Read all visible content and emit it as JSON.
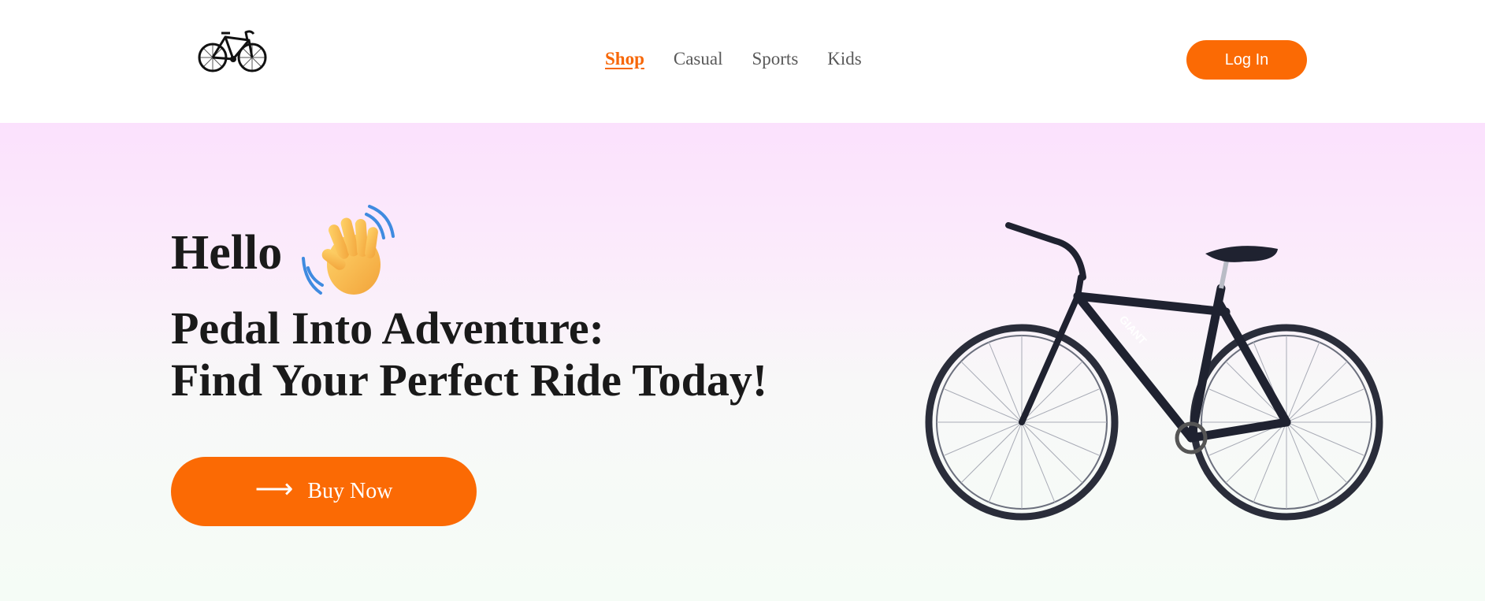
{
  "header": {
    "logo_icon": "bicycle-logo-icon",
    "nav": [
      {
        "label": "Shop",
        "active": true
      },
      {
        "label": "Casual",
        "active": false
      },
      {
        "label": "Sports",
        "active": false
      },
      {
        "label": "Kids",
        "active": false
      }
    ],
    "login_label": "Log In"
  },
  "hero": {
    "greeting": "Hello",
    "greeting_icon": "waving-hand-icon",
    "headline_line1": "Pedal Into Adventure:",
    "headline_line2": "Find Your Perfect Ride Today!",
    "cta_label": "Buy Now",
    "cta_icon": "arrow-right-icon",
    "image": "bicycle-photo",
    "bike_frame_text": "GIANT"
  },
  "colors": {
    "accent": "#fb6a04",
    "nav_active": "#f76707",
    "nav_text": "#595959",
    "heading": "#1a1a1a",
    "hero_gradient_top": "#fbe1fd",
    "hero_gradient_bottom": "#f5fcf6"
  }
}
